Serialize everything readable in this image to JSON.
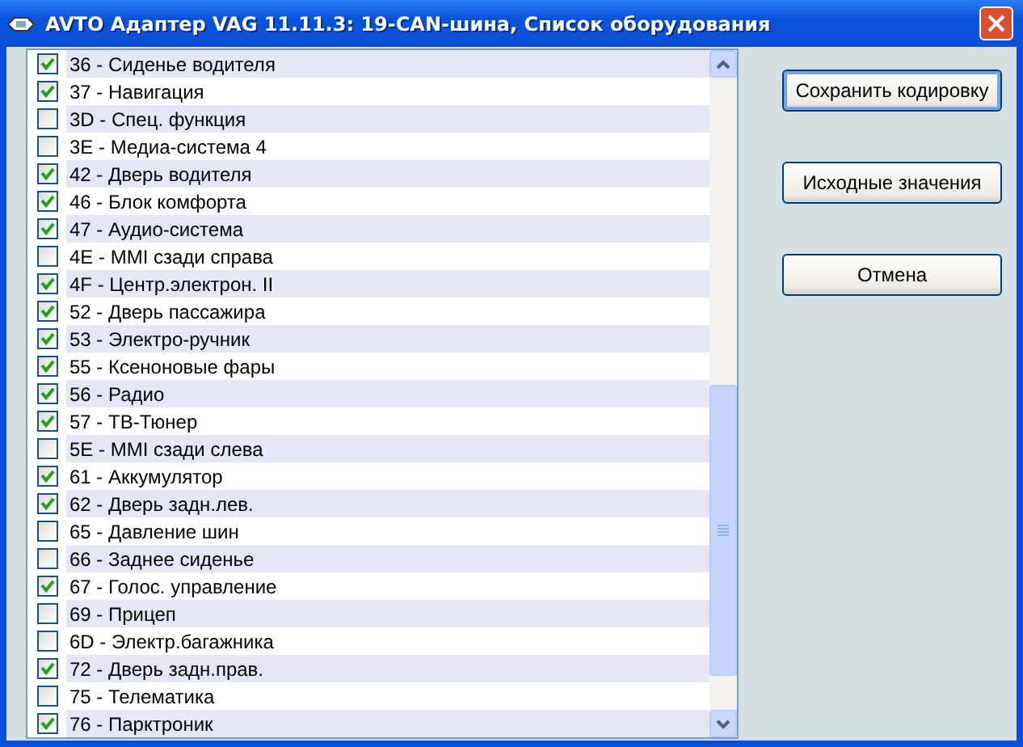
{
  "window": {
    "title": "AVTO Адаптер VAG 11.11.3: 19-CAN-шина,  Список оборудования"
  },
  "items": [
    {
      "label": "36 - Сиденье водителя",
      "checked": true
    },
    {
      "label": "37 - Навигация",
      "checked": true
    },
    {
      "label": "3D - Спец. функция",
      "checked": false
    },
    {
      "label": "3E - Медиа-система 4",
      "checked": false
    },
    {
      "label": "42 - Дверь водителя",
      "checked": true
    },
    {
      "label": "46 - Блок комфорта",
      "checked": true
    },
    {
      "label": "47 - Аудио-система",
      "checked": true
    },
    {
      "label": "4E - MMI сзади справа",
      "checked": false
    },
    {
      "label": "4F - Центр.электрон. II",
      "checked": true
    },
    {
      "label": "52 - Дверь пассажира",
      "checked": true
    },
    {
      "label": "53 - Электро-ручник",
      "checked": true
    },
    {
      "label": "55 - Ксеноновые фары",
      "checked": true
    },
    {
      "label": "56 - Радио",
      "checked": true
    },
    {
      "label": "57 - ТВ-Тюнер",
      "checked": true
    },
    {
      "label": "5E - MMI сзади слева",
      "checked": false
    },
    {
      "label": "61 - Аккумулятор",
      "checked": true
    },
    {
      "label": "62 - Дверь задн.лев.",
      "checked": true
    },
    {
      "label": "65 - Давление шин",
      "checked": false
    },
    {
      "label": "66 - Заднее сиденье",
      "checked": false
    },
    {
      "label": "67 - Голос. управление",
      "checked": true
    },
    {
      "label": "69 - Прицеп",
      "checked": false
    },
    {
      "label": "6D - Электр.багажника",
      "checked": false
    },
    {
      "label": "72 - Дверь задн.прав.",
      "checked": true
    },
    {
      "label": "75 - Телематика",
      "checked": false
    },
    {
      "label": "76 - Парктроник",
      "checked": true
    }
  ],
  "buttons": [
    {
      "label": "Сохранить кодировку",
      "default": true
    },
    {
      "label": "Исходные значения",
      "default": false
    },
    {
      "label": "Отмена",
      "default": false
    }
  ]
}
